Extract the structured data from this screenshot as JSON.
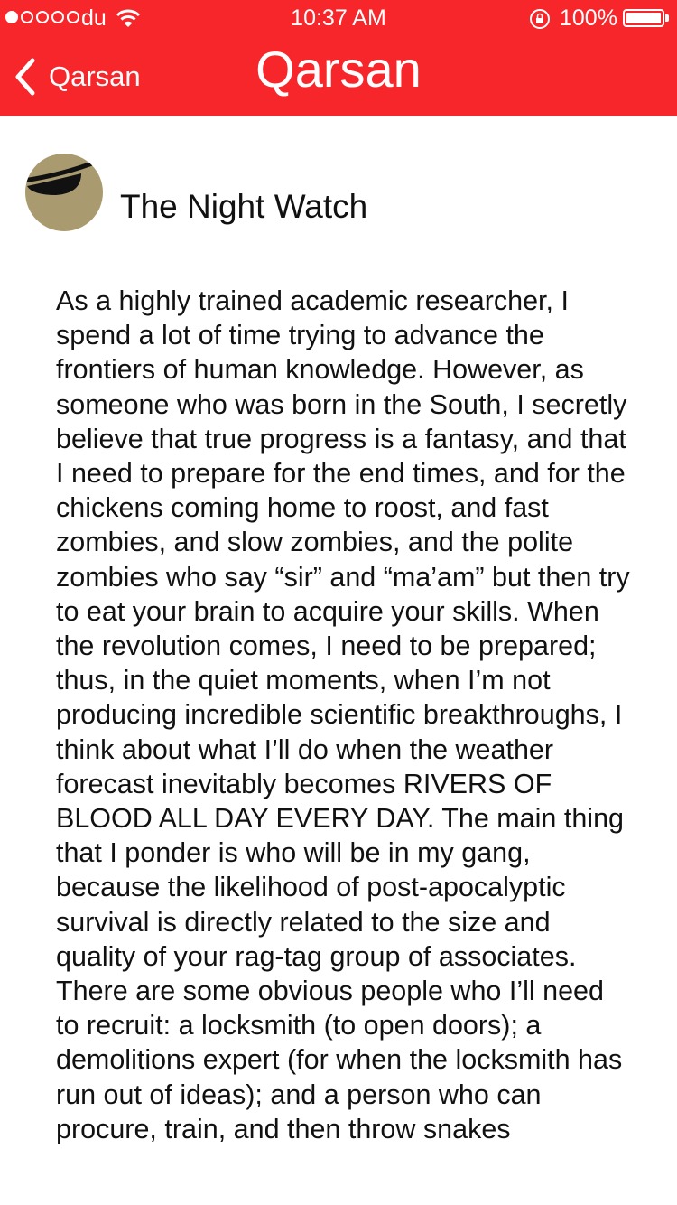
{
  "status_bar": {
    "carrier": "du",
    "time": "10:37 AM",
    "battery": "100%",
    "signal_bars": 1,
    "icons": [
      "signal-icon",
      "wifi-icon",
      "orientation-lock-icon",
      "battery-icon"
    ]
  },
  "nav": {
    "back_label": "Qarsan",
    "title": "Qarsan",
    "bar_color": "#f7262a"
  },
  "author": {
    "name": "The Night Watch",
    "avatar": "eyepatch-avatar",
    "avatar_color": "#a99a6f"
  },
  "article": {
    "text": "As a highly trained academic researcher, I spend a lot of time trying to advance the frontiers of human knowledge. However, as someone who was born in the South, I secretly believe that true progress is a fantasy, and that I need to prepare for the end times, and for the chickens coming home to roost, and fast zombies, and slow zombies, and the polite zombies who say “sir” and “ma’am” but then try to eat your brain to acquire your skills. When the revolution comes, I need to be prepared; thus, in the quiet moments, when I’m not producing incredible scientific breakthroughs, I think about what I’ll do when the weather forecast inevitably becomes RIVERS OF BLOOD ALL DAY EVERY DAY. The main thing that I ponder is who will be in my gang, because the likelihood of post-apocalyptic survival is directly related to the size and quality of your rag-tag group of associates. There are some obvious people who I’ll need to recruit: a locksmith (to open doors); a demolitions expert (for when the locksmith has run out of ideas); and a person who can procure, train, and then throw snakes"
  }
}
